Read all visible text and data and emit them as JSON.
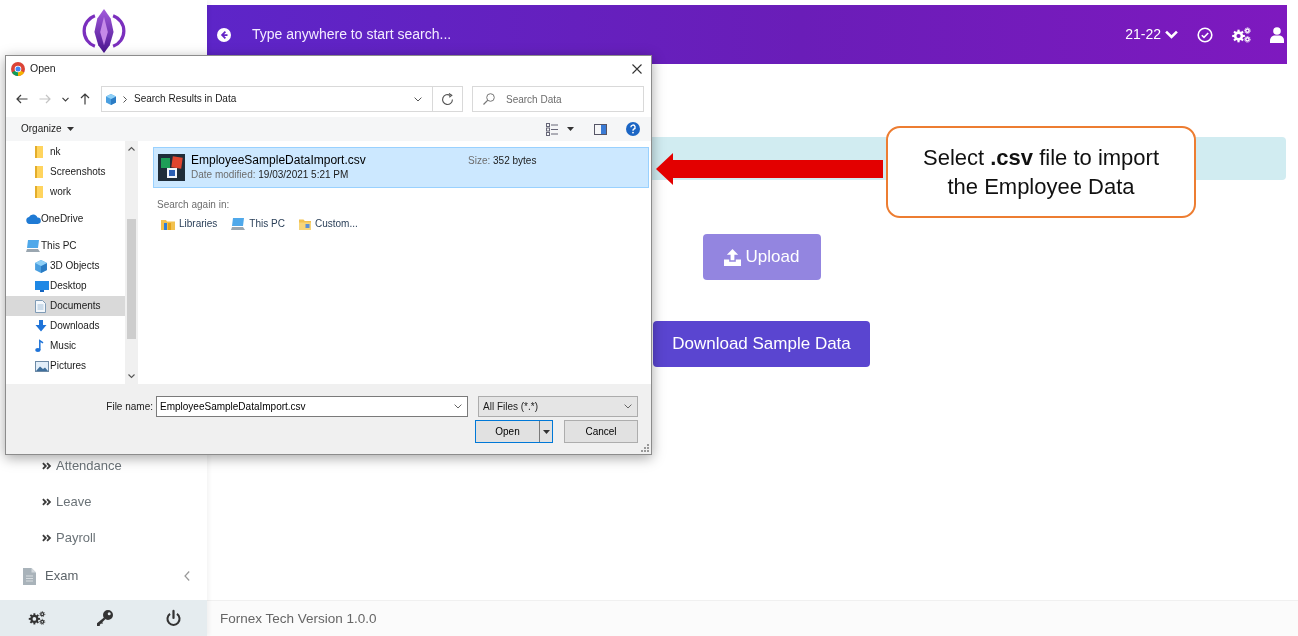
{
  "sidebar": {
    "menu_items": [
      {
        "label": "Attendance",
        "kind": "subitem",
        "selected": false
      },
      {
        "label": "Leave",
        "kind": "subitem",
        "selected": false
      },
      {
        "label": "Payroll",
        "kind": "subitem",
        "selected": false
      },
      {
        "label": "Exam",
        "kind": "section",
        "selected": false,
        "expanded": false
      }
    ]
  },
  "top_bar": {
    "search": {
      "placeholder": "Type anywhere to start search..."
    },
    "session": "21-22"
  },
  "main": {
    "buttons": [
      {
        "label": "Upload",
        "kind": "upload",
        "disabled": true
      },
      {
        "label": "Download Sample Data",
        "kind": "download",
        "disabled": false
      }
    ]
  },
  "footer": {
    "text": "Fornex Tech Version 1.0.0"
  },
  "dialog": {
    "title": "Open",
    "nav_buttons": [
      {
        "kind": "back",
        "disabled": false
      },
      {
        "kind": "forward",
        "disabled": true
      },
      {
        "kind": "recent",
        "disabled": false
      },
      {
        "kind": "up",
        "disabled": false
      }
    ],
    "address": "Search Results in Data",
    "search": {
      "placeholder": "Search Data"
    },
    "toolbar": {
      "organize": "Organize"
    },
    "nav_pane": {
      "items": [
        {
          "children": [
            {
              "label": "nk",
              "kind": "folder",
              "selected": false
            },
            {
              "label": "Screenshots",
              "kind": "folder",
              "selected": false
            },
            {
              "label": "work",
              "kind": "folder",
              "selected": false
            }
          ]
        },
        {
          "label": "OneDrive",
          "kind": "cloud",
          "selected": false
        },
        {
          "label": "This PC",
          "kind": "computer",
          "selected": false,
          "children": [
            {
              "label": "3D Objects",
              "kind": "cube",
              "selected": false
            },
            {
              "label": "Desktop",
              "kind": "monitor",
              "selected": false
            },
            {
              "label": "Documents",
              "kind": "document",
              "selected": true
            },
            {
              "label": "Downloads",
              "kind": "download",
              "selected": false
            },
            {
              "label": "Music",
              "kind": "music",
              "selected": false
            },
            {
              "label": "Pictures",
              "kind": "picture",
              "selected": false
            }
          ]
        }
      ]
    },
    "results": [
      {
        "name": "EmployeeSampleDataImport.csv",
        "date_label": "Date modified:",
        "date": "19/03/2021 5:21 PM",
        "size_label": "Size:",
        "size": "352 bytes",
        "selected": true
      }
    ],
    "search_again": {
      "label": "Search again in:",
      "locations": [
        {
          "label": "Libraries",
          "kind": "libraries"
        },
        {
          "label": "This PC",
          "kind": "computer"
        },
        {
          "label": "Custom...",
          "kind": "custom"
        }
      ]
    },
    "file_name": {
      "label": "File name:",
      "value": "EmployeeSampleDataImport.csv"
    },
    "file_type": {
      "value": "All Files (*.*)"
    },
    "buttons": [
      {
        "label": "Open",
        "kind": "split",
        "default": true
      },
      {
        "label": "Cancel",
        "kind": "plain",
        "default": false
      }
    ]
  },
  "callout": {
    "text": "Select **.csv** file to import the Employee Data"
  }
}
